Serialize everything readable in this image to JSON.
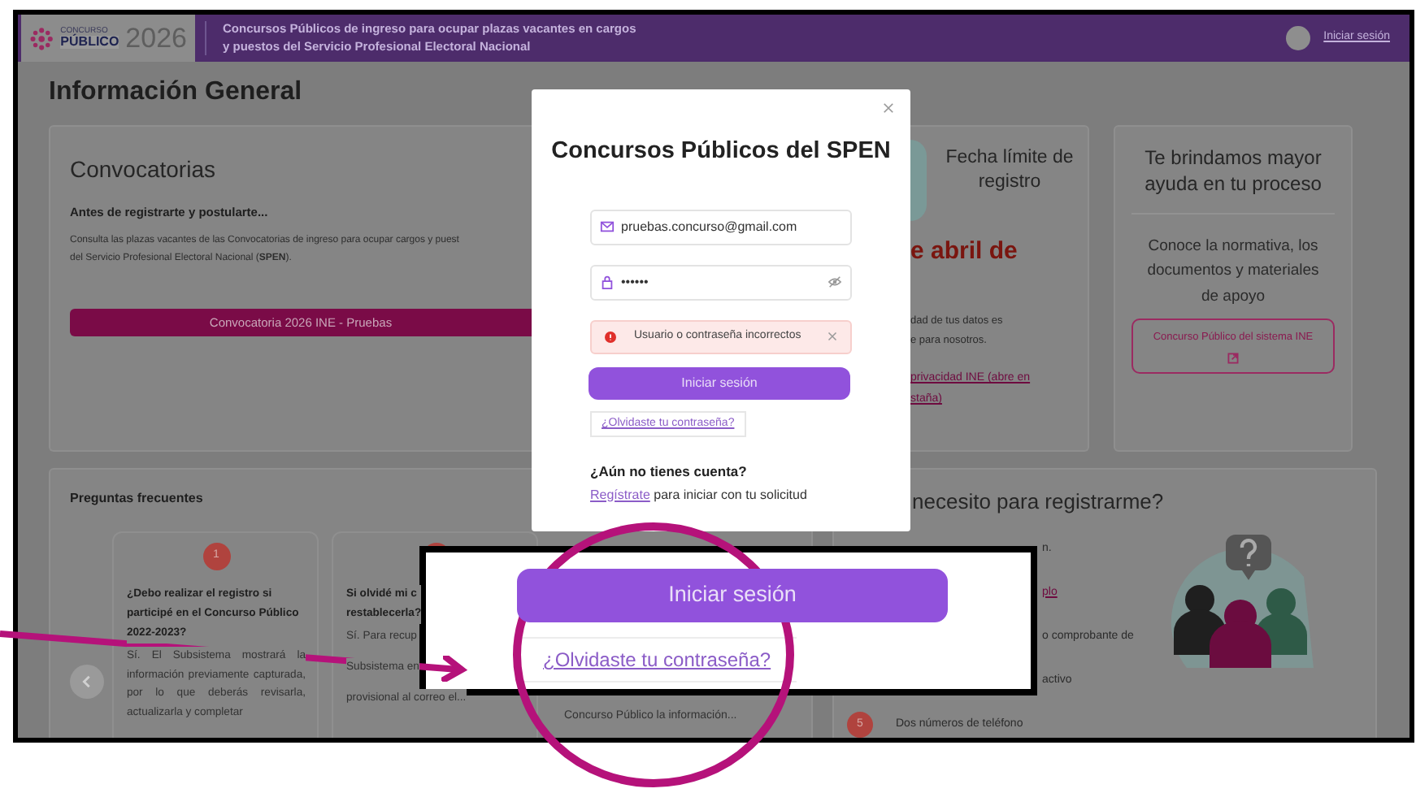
{
  "header": {
    "logo": {
      "top": "CONCURSO",
      "main": "PÚBLICO",
      "year": "2026"
    },
    "title_lines": [
      "Concursos Públicos de ingreso para ocupar plazas vacantes en cargos",
      "y puestos del Servicio Profesional Electoral Nacional"
    ],
    "login": "Iniciar sesión"
  },
  "page_title": "Información General",
  "convocatorias": {
    "title": "Convocatorias",
    "subtitle": "Antes de registrarte y postularte...",
    "text_lines": [
      "Consulta las plazas vacantes de las Convocatorias de ingreso para ocupar cargos y puest",
      "del Servicio Profesional Electoral Nacional (**SPEN**)."
    ],
    "button": "Convocatoria 2026 INE - Pruebas"
  },
  "deadline": {
    "title": "Fecha límite de registro",
    "date": "e abril de",
    "privacy_lines": [
      "dad de tus datos es",
      "e para nosotros."
    ],
    "privacy_link_lines": [
      "privacidad INE (abre en",
      "staña)"
    ]
  },
  "help": {
    "title": "Te brindamos mayor ayuda en tu proceso",
    "text": "Conoce la normativa, los documentos y materiales de apoyo",
    "button": "Concurso Público del sistema INE"
  },
  "faq": {
    "title": "Preguntas frecuentes",
    "items": [
      {
        "kind": "full",
        "number": "1",
        "question": "¿Debo realizar el registro si participé en el Concurso Público 2022-2023?",
        "answer": "Sí. El Subsistema mostrará la información previamente capturada, por lo que deberás revisarla, actualizarla y completar"
      },
      {
        "kind": "partial",
        "question_lines": [
          "Si olvidé mi c",
          "restablecerla?"
        ],
        "answer_lines": [
          "Sí. Para recup",
          "Subsistema en",
          "provisional al correo el..."
        ]
      },
      {
        "kind": "tail",
        "answer_lines": [
          "Concurso Público la información..."
        ]
      }
    ]
  },
  "requirements": {
    "title": "necesito para registrarme?",
    "items": [
      {
        "kind": "partial",
        "text": "n."
      },
      {
        "kind": "partial-link",
        "text": "plo"
      },
      {
        "kind": "partial",
        "text": "o comprobante de"
      },
      {
        "kind": "partial",
        "text": "activo"
      },
      {
        "kind": "numbered",
        "number": "5",
        "text": "Dos números de teléfono"
      }
    ]
  },
  "login_modal": {
    "title": "Concursos Públicos del SPEN",
    "email": "pruebas.concurso@gmail.com",
    "password": "••••••",
    "error": "Usuario o contraseña incorrectos",
    "submit": "Iniciar sesión",
    "forgot": "¿Olvidaste tu contraseña?",
    "signup_question": "¿Aún no tienes cuenta?",
    "signup_link": "Regístrate",
    "signup_rest": "para iniciar con tu solicitud"
  },
  "zoom_inset": {
    "submit": "Iniciar sesión",
    "forgot": "¿Olvidaste tu contraseña?"
  }
}
